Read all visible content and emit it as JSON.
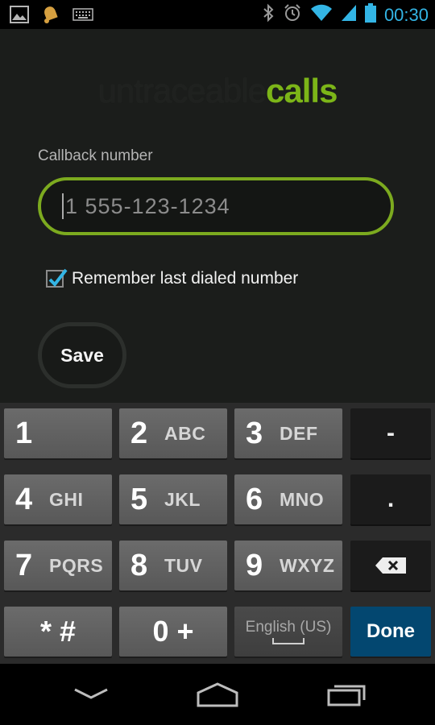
{
  "status_bar": {
    "time": "00:30",
    "left_icons": [
      "gallery-icon",
      "notification-bell-icon",
      "keyboard-icon"
    ],
    "right_icons": [
      "bluetooth-icon",
      "alarm-icon",
      "wifi-icon",
      "signal-icon",
      "battery-icon"
    ],
    "accent_color": "#33b5e5"
  },
  "app": {
    "logo_part1": "untraceable",
    "logo_part2": "calls",
    "brand_color": "#7cb518",
    "callback_label": "Callback number",
    "phone_placeholder": "1 555-123-1234",
    "phone_value": "",
    "remember_label": "Remember last dialed number",
    "remember_checked": true,
    "save_label": "Save"
  },
  "keyboard": {
    "rows": [
      [
        {
          "num": "1",
          "letters": ""
        },
        {
          "num": "2",
          "letters": "ABC"
        },
        {
          "num": "3",
          "letters": "DEF"
        },
        {
          "sym": "-"
        }
      ],
      [
        {
          "num": "4",
          "letters": "GHI"
        },
        {
          "num": "5",
          "letters": "JKL"
        },
        {
          "num": "6",
          "letters": "MNO"
        },
        {
          "sym": "."
        }
      ],
      [
        {
          "num": "7",
          "letters": "PQRS"
        },
        {
          "num": "8",
          "letters": "TUV"
        },
        {
          "num": "9",
          "letters": "WXYZ"
        },
        {
          "sym": "backspace"
        }
      ],
      [
        {
          "label": "* #"
        },
        {
          "label": "0 +"
        },
        {
          "label": "English (US)"
        },
        {
          "label": "Done"
        }
      ]
    ],
    "star_hash": "* #",
    "zero_plus": "0 +",
    "language": "English (US)",
    "done_label": "Done",
    "done_color": "#034770"
  },
  "nav_bar": {
    "buttons": [
      "back-icon",
      "home-icon",
      "recent-apps-icon"
    ]
  }
}
